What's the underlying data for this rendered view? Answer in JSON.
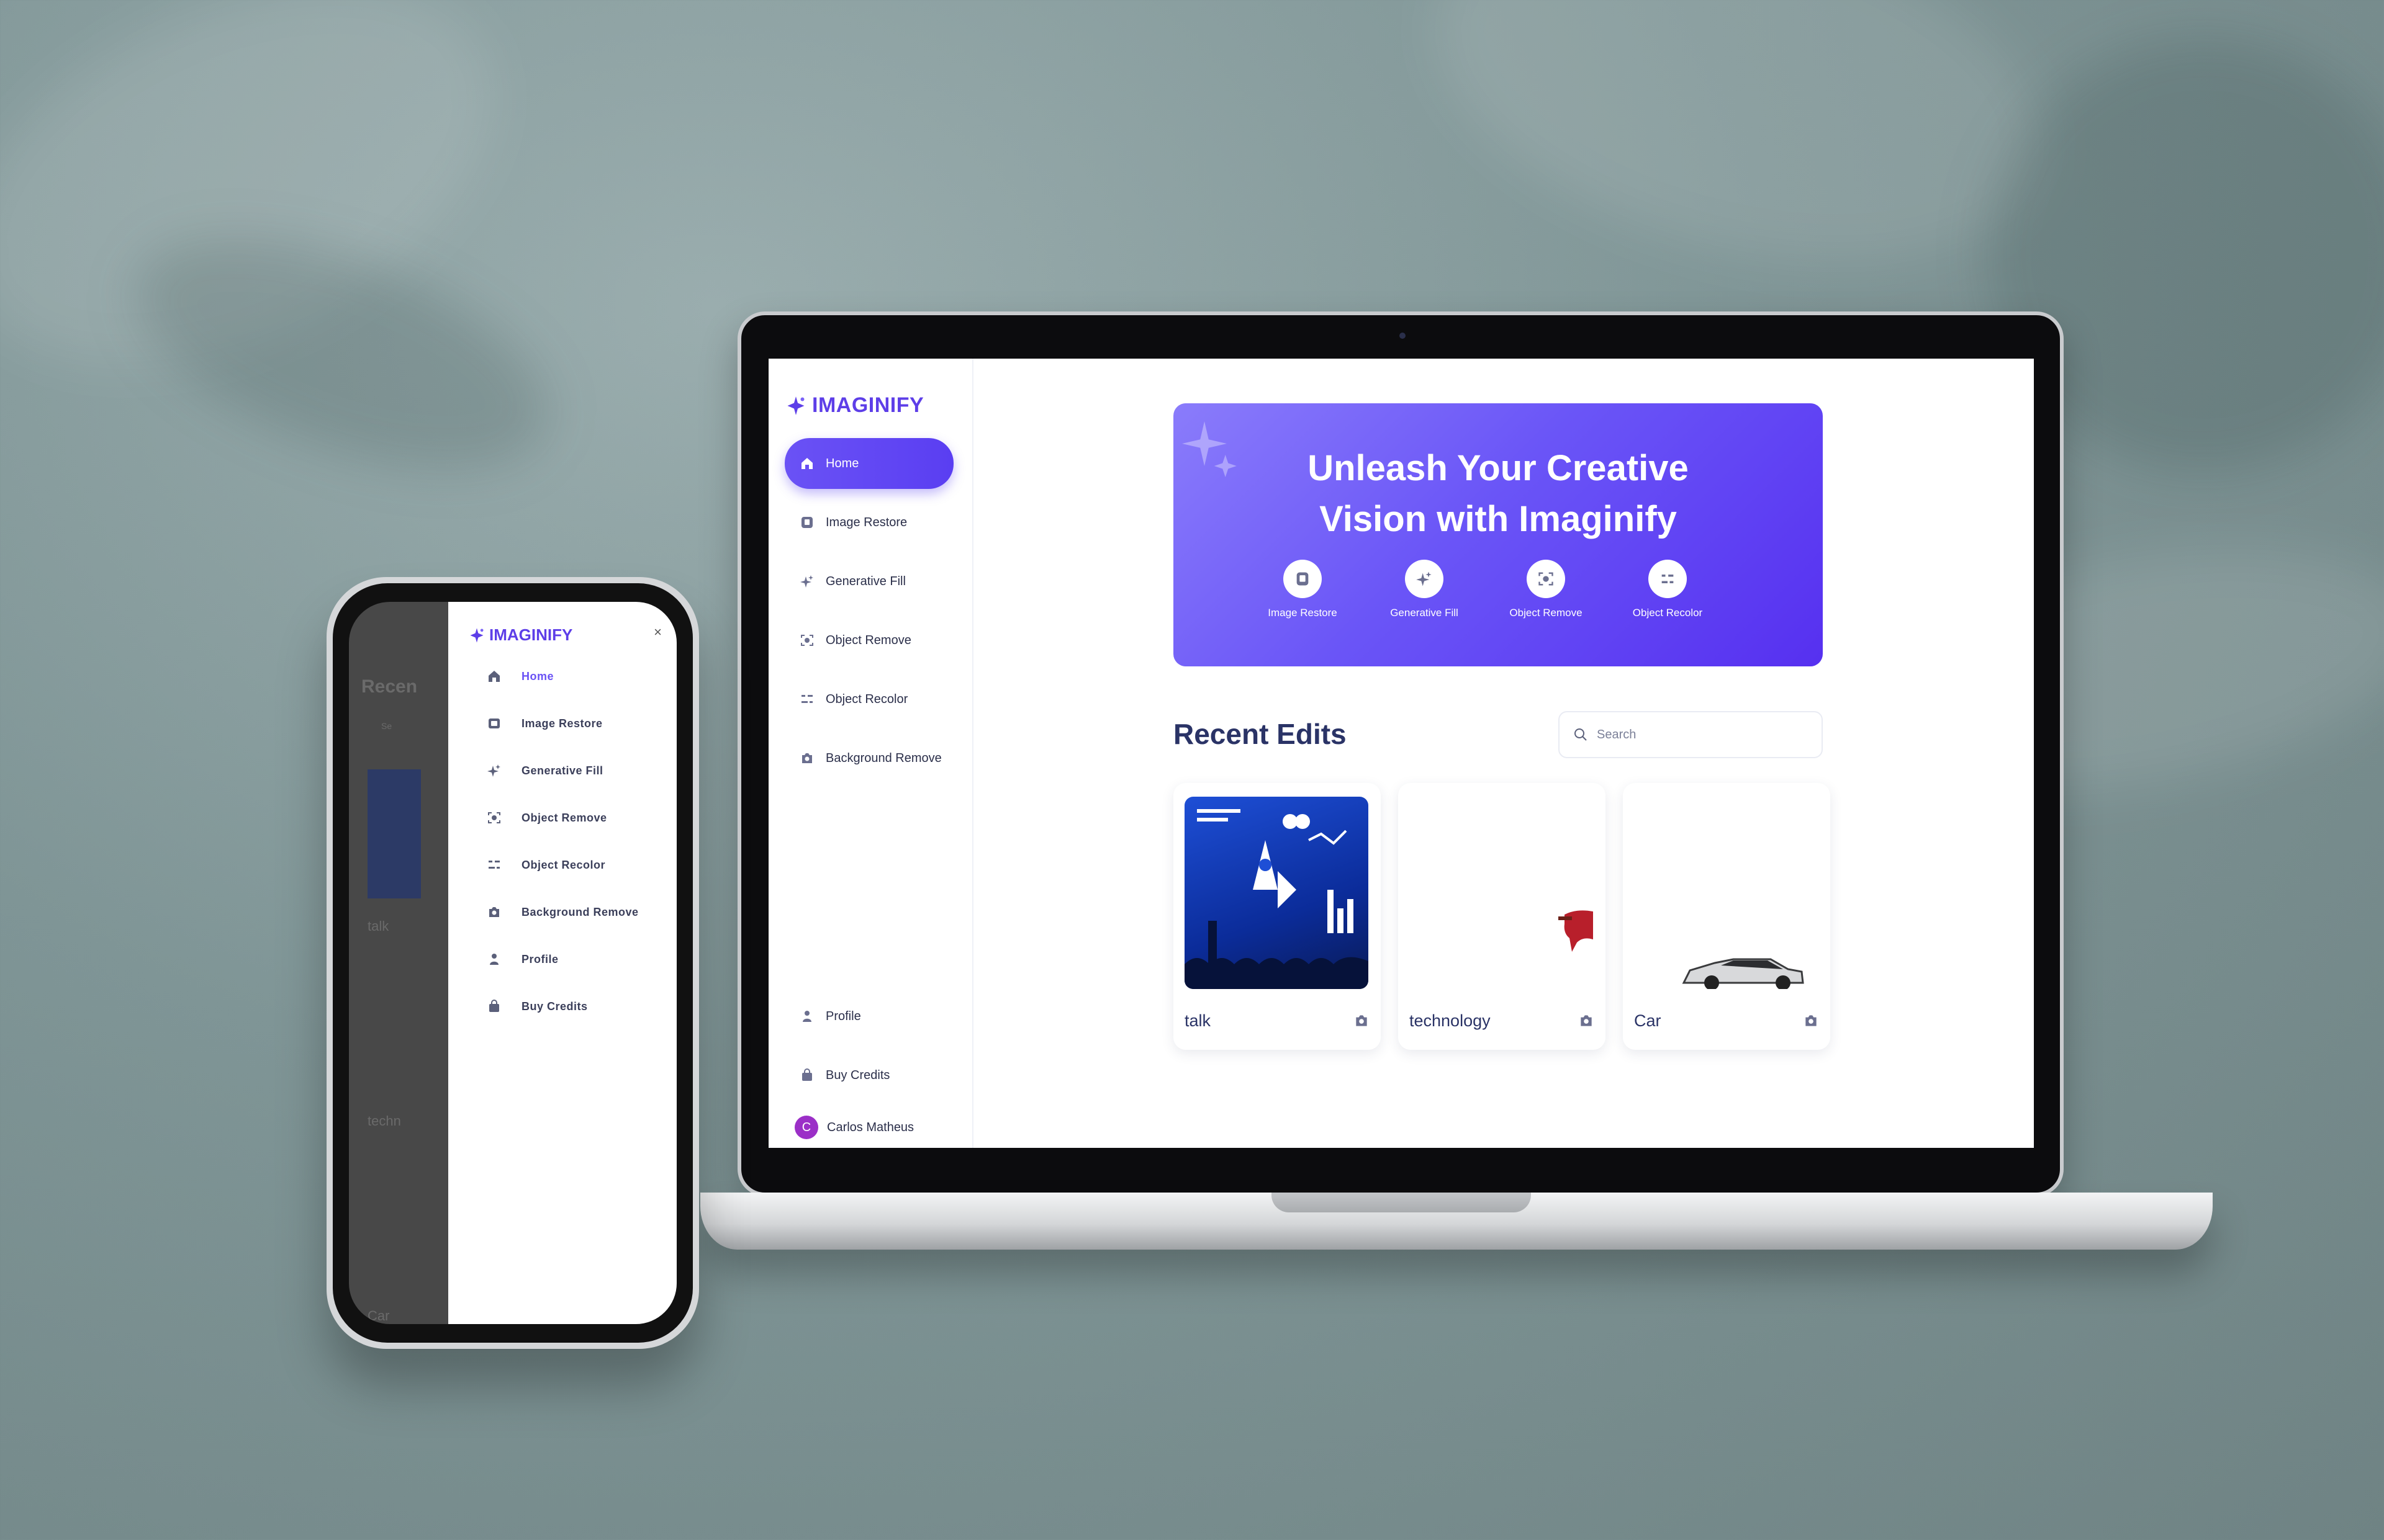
{
  "app": {
    "name": "IMAGINIFY"
  },
  "sidebar": {
    "items": [
      {
        "label": "Home",
        "icon": "home-icon",
        "active": true
      },
      {
        "label": "Image Restore",
        "icon": "image-icon"
      },
      {
        "label": "Generative Fill",
        "icon": "stars-icon"
      },
      {
        "label": "Object Remove",
        "icon": "scan-icon"
      },
      {
        "label": "Object Recolor",
        "icon": "filter-icon"
      },
      {
        "label": "Background Remove",
        "icon": "camera-icon"
      }
    ],
    "bottom_items": [
      {
        "label": "Profile",
        "icon": "user-icon"
      },
      {
        "label": "Buy Credits",
        "icon": "bag-icon"
      }
    ],
    "user": {
      "initial": "C",
      "name": "Carlos Matheus"
    }
  },
  "hero": {
    "title": "Unleash Your Creative\nVision with Imaginify",
    "tools": [
      {
        "label": "Image Restore",
        "icon": "image-icon"
      },
      {
        "label": "Generative Fill",
        "icon": "stars-icon"
      },
      {
        "label": "Object Remove",
        "icon": "scan-icon"
      },
      {
        "label": "Object Recolor",
        "icon": "filter-icon"
      }
    ]
  },
  "recent": {
    "title": "Recent Edits",
    "search_placeholder": "Search",
    "cards": [
      {
        "label": "talk",
        "icon": "camera-icon"
      },
      {
        "label": "technology",
        "icon": "camera-icon"
      },
      {
        "label": "Car",
        "icon": "camera-icon"
      }
    ]
  },
  "mobile": {
    "logo": "IMAGINIFY",
    "close": "×",
    "bg": {
      "title": "Recen",
      "search": "Se",
      "cards": [
        "talk",
        "techn",
        "Car"
      ]
    },
    "menu": [
      {
        "label": "Home",
        "active": true
      },
      {
        "label": "Image Restore"
      },
      {
        "label": "Generative Fill"
      },
      {
        "label": "Object Remove"
      },
      {
        "label": "Object Recolor"
      },
      {
        "label": "Background Remove"
      },
      {
        "label": "Profile"
      },
      {
        "label": "Buy Credits"
      }
    ]
  },
  "colors": {
    "accent": "#5d3ee8",
    "hero_start": "#8a7cfb",
    "hero_end": "#5630f0",
    "text_dark": "#2a3366"
  }
}
